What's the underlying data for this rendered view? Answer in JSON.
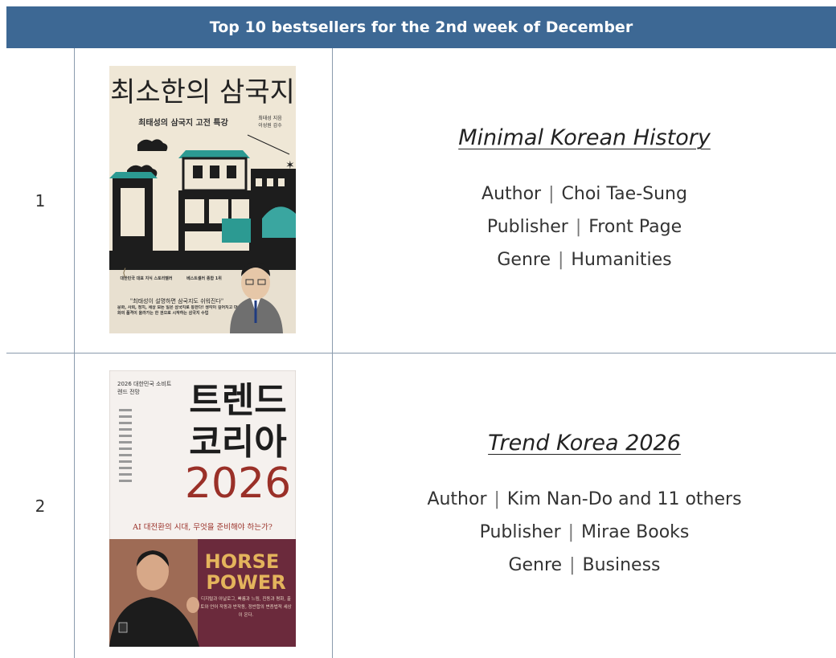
{
  "header": {
    "title": "Top 10 bestsellers for the 2nd week of December"
  },
  "books": [
    {
      "rank": "1",
      "title": "Minimal Korean History",
      "author_label": "Author",
      "author": "Choi Tae-Sung",
      "publisher_label": "Publisher",
      "publisher": "Front Page",
      "genre_label": "Genre",
      "genre": "Humanities",
      "cover": {
        "title_kr": "최소한의 삼국지",
        "subtitle_kr": "최태성의 삼국지 고전 특강",
        "author_kr": "최태성 지음",
        "supervisor_kr": "이성원 감수",
        "badge1_kr": "대한민국 대표 지식 스토리텔러",
        "badge2_kr": "베스트셀러 종합 1위",
        "quote_kr": "\"최태성이 설명하면 삼국지도 쉬워진다\"",
        "blurb_kr": "문화, 사회, 정치, 세상 모든 일은 삼국지로 통한다! 생각이 깊어지고 대화의 품격이 올라가는 한 권으로 시작하는 삼국지 수업",
        "bg": "#efe7d6",
        "accent": "#3aa6a0"
      }
    },
    {
      "rank": "2",
      "title": "Trend Korea 2026",
      "author_label": "Author",
      "author": "Kim Nan-Do and 11 others",
      "publisher_label": "Publisher",
      "publisher": "Mirae Books",
      "genre_label": "Genre",
      "genre": "Business",
      "cover": {
        "kicker_kr": "2026 대한민국 소비트렌드 전망",
        "title1_kr": "트렌드",
        "title2_kr": "코리아",
        "year": "2026",
        "tagline_kr": "AI 대전환의 시대, 무엇을 준비해야 하는가?",
        "band_line1": "HORSE",
        "band_line2": "POWER",
        "band_text_kr": "디지털과 아날로그, 빠름과 느림, 진동과 평화, 출토와 언어 작동과 반작동, 정반합의 변증법적 세상이 온다.",
        "red": "#9a3028",
        "band_bg": "#6b2a3c",
        "gold": "#e4b45c"
      }
    }
  ]
}
